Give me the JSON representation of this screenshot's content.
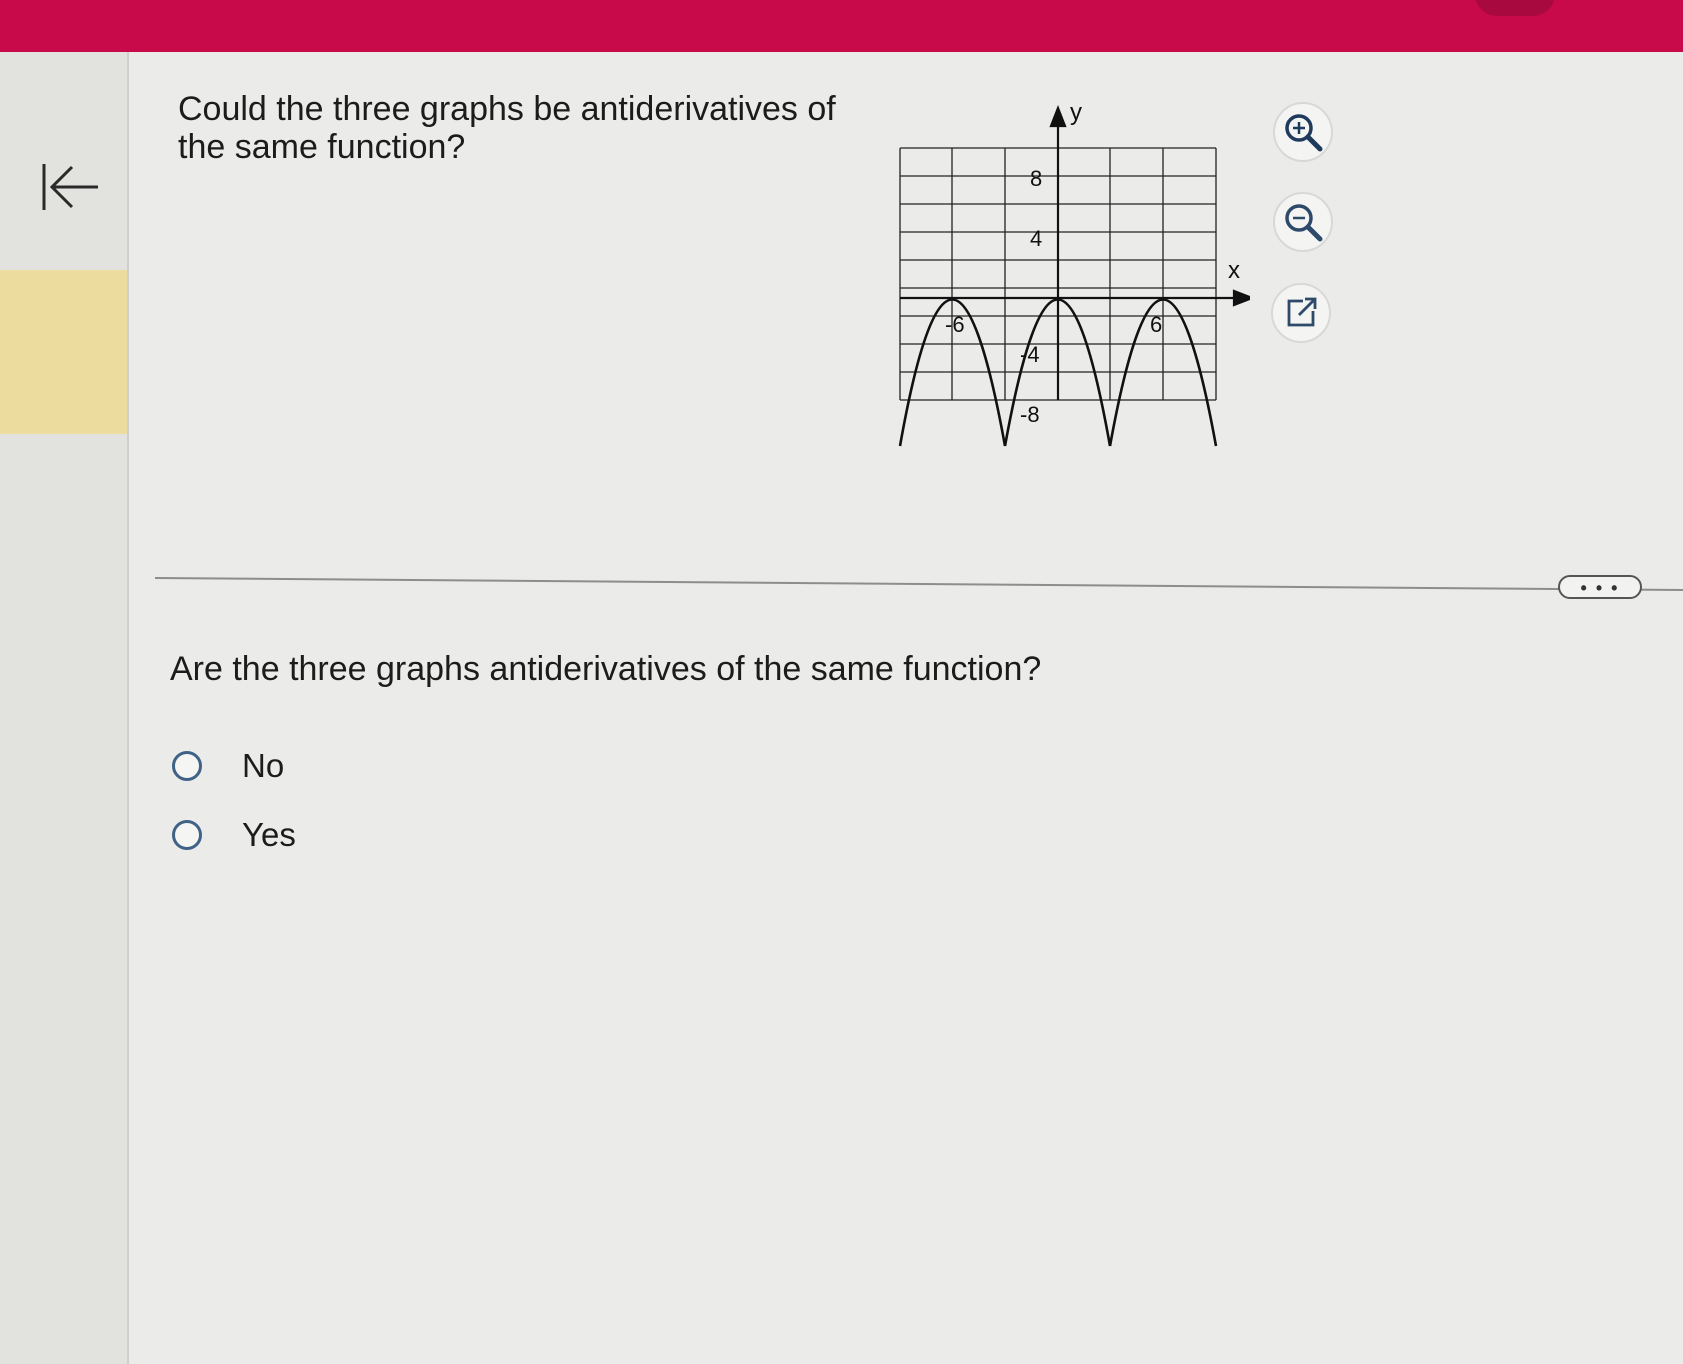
{
  "question": {
    "title": "Could the three graphs be antiderivatives of the same function?",
    "prompt": "Are the three graphs antiderivatives of the same function?"
  },
  "graph": {
    "x_axis_label": "x",
    "y_axis_label": "y",
    "x_ticks": [
      "-6",
      "6"
    ],
    "y_ticks": [
      "8",
      "4",
      "-4",
      "-8"
    ]
  },
  "graph_tools": [
    "zoom-in-icon",
    "zoom-out-icon",
    "external-link-icon"
  ],
  "more_button_label": "• • •",
  "options": [
    {
      "label": "No",
      "selected": false
    },
    {
      "label": "Yes",
      "selected": false
    }
  ],
  "colors": {
    "top_bar": "#c80a4b",
    "radio_border": "#3f6286",
    "highlight": "#ecdc9e"
  }
}
